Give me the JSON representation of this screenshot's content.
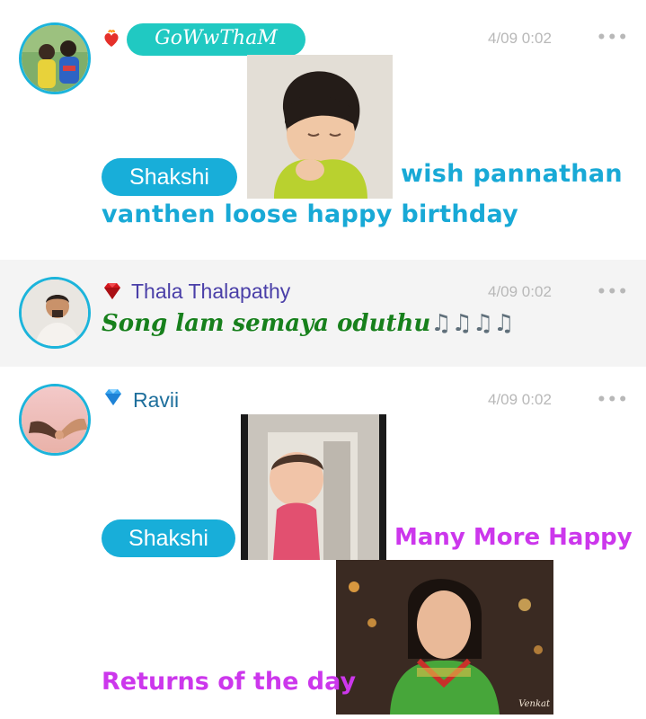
{
  "posts": [
    {
      "username": "GoWwThaM",
      "time": "4/09 0:02",
      "more": "•••",
      "mention": "Shakshi",
      "message_line1": "wish pannathan",
      "message_line2": "vanthen loose happy birthday",
      "badge_icon": "flaming-heart-icon"
    },
    {
      "username": "Thala Thalapathy",
      "time": "4/09 0:02",
      "more": "•••",
      "message": "Song lam semaya oduthu",
      "music_notes": "♫♫♫♫",
      "badge_icon": "red-gem-icon"
    },
    {
      "username": "Ravii",
      "time": "4/09 0:02",
      "more": "•••",
      "mention": "Shakshi",
      "message_line1": "Many More Happy",
      "message_line2": "Returns of the day",
      "watermark": "Venkat",
      "badge_icon": "blue-diamond-icon"
    }
  ],
  "colors": {
    "accent": "#18aed9",
    "purple_text": "#cc37ec",
    "green_text": "#17801c",
    "meta_gray": "#b8b8b8"
  }
}
